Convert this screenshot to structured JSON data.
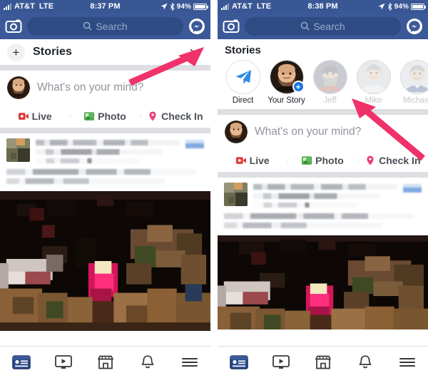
{
  "accent": {
    "fb_blue": "#3b5998",
    "search_blue": "#2f4b83",
    "arrow_pink": "#f0326a",
    "live_red": "#e0383a",
    "photo_green": "#5fbc5b",
    "checkin_pink": "#ec3b7d",
    "story_badge_blue": "#1b74e4"
  },
  "left": {
    "status": {
      "carrier": "AT&T",
      "network": "LTE",
      "time": "8:37 PM",
      "battery_pct": "94%",
      "icons": [
        "signal-bars-icon",
        "location-arrow-icon",
        "bluetooth-icon",
        "battery-icon"
      ]
    },
    "header": {
      "camera_icon": "camera-icon",
      "search_placeholder": "Search",
      "search_icon": "search-icon",
      "messenger_icon": "messenger-icon"
    },
    "stories": {
      "add_label": "+",
      "title": "Stories",
      "collapse_icon": "chevron-down-icon"
    },
    "composer": {
      "placeholder": "What's on your mind?",
      "avatar": "user-avatar"
    },
    "actions": [
      {
        "label": "Live",
        "icon": "live-video-icon"
      },
      {
        "label": "Photo",
        "icon": "photo-icon"
      },
      {
        "label": "Check In",
        "icon": "location-pin-icon"
      }
    ],
    "annotation": {
      "type": "arrow",
      "points_to": "stories-collapse-chevron"
    }
  },
  "right": {
    "status": {
      "carrier": "AT&T",
      "network": "LTE",
      "time": "8:38 PM",
      "battery_pct": "94%",
      "icons": [
        "signal-bars-icon",
        "location-arrow-icon",
        "bluetooth-icon",
        "battery-icon"
      ]
    },
    "header": {
      "camera_icon": "camera-icon",
      "search_placeholder": "Search",
      "search_icon": "search-icon",
      "messenger_icon": "messenger-icon"
    },
    "stories": {
      "title": "Stories",
      "items": [
        {
          "label": "Direct",
          "icon": "paper-plane-icon",
          "kind": "direct",
          "dim": false
        },
        {
          "label": "Your Story",
          "kind": "own",
          "badge": "+",
          "dim": false
        },
        {
          "label": "Jeff",
          "kind": "friend",
          "dim": true
        },
        {
          "label": "Mike",
          "kind": "friend",
          "dim": true
        },
        {
          "label": "Michael",
          "kind": "friend",
          "dim": true
        },
        {
          "label": "",
          "kind": "partial",
          "dim": true
        }
      ]
    },
    "composer": {
      "placeholder": "What's on your mind?",
      "avatar": "user-avatar"
    },
    "actions": [
      {
        "label": "Live",
        "icon": "live-video-icon"
      },
      {
        "label": "Photo",
        "icon": "photo-icon"
      },
      {
        "label": "Check In",
        "icon": "location-pin-icon"
      }
    ],
    "annotation": {
      "type": "arrow",
      "points_to": "story-jeff-mike"
    }
  },
  "tabbar": [
    {
      "name": "news-feed-icon",
      "label": "News Feed",
      "active": true
    },
    {
      "name": "watch-video-icon",
      "label": "Watch",
      "active": false
    },
    {
      "name": "marketplace-icon",
      "label": "Marketplace",
      "active": false
    },
    {
      "name": "notifications-bell-icon",
      "label": "Notifications",
      "active": false
    },
    {
      "name": "menu-hamburger-icon",
      "label": "Menu",
      "active": false
    }
  ]
}
